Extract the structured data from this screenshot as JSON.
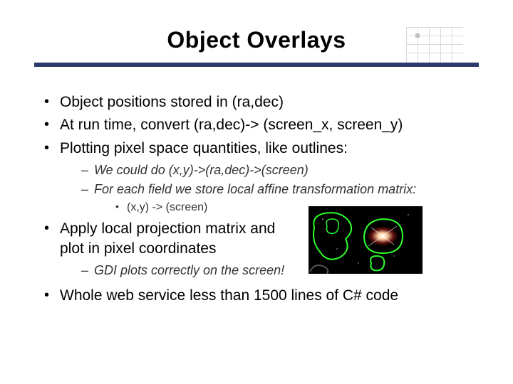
{
  "title": "Object Overlays",
  "bullets": {
    "b1": "Object positions stored in (ra,dec)",
    "b2": "At run time, convert (ra,dec)-> (screen_x, screen_y)",
    "b3": "Plotting pixel space quantities, like outlines:",
    "b3_sub1": "We could do (x,y)->(ra,dec)->(screen)",
    "b3_sub2": "For each field we store local affine transformation matrix:",
    "b3_sub2_a": "(x,y) -> (screen)",
    "b4": "Apply local projection matrix and plot in pixel coordinates",
    "b4_sub1": "GDI plots correctly on the screen!",
    "b5": "Whole web service less than 1500 lines of C# code"
  }
}
